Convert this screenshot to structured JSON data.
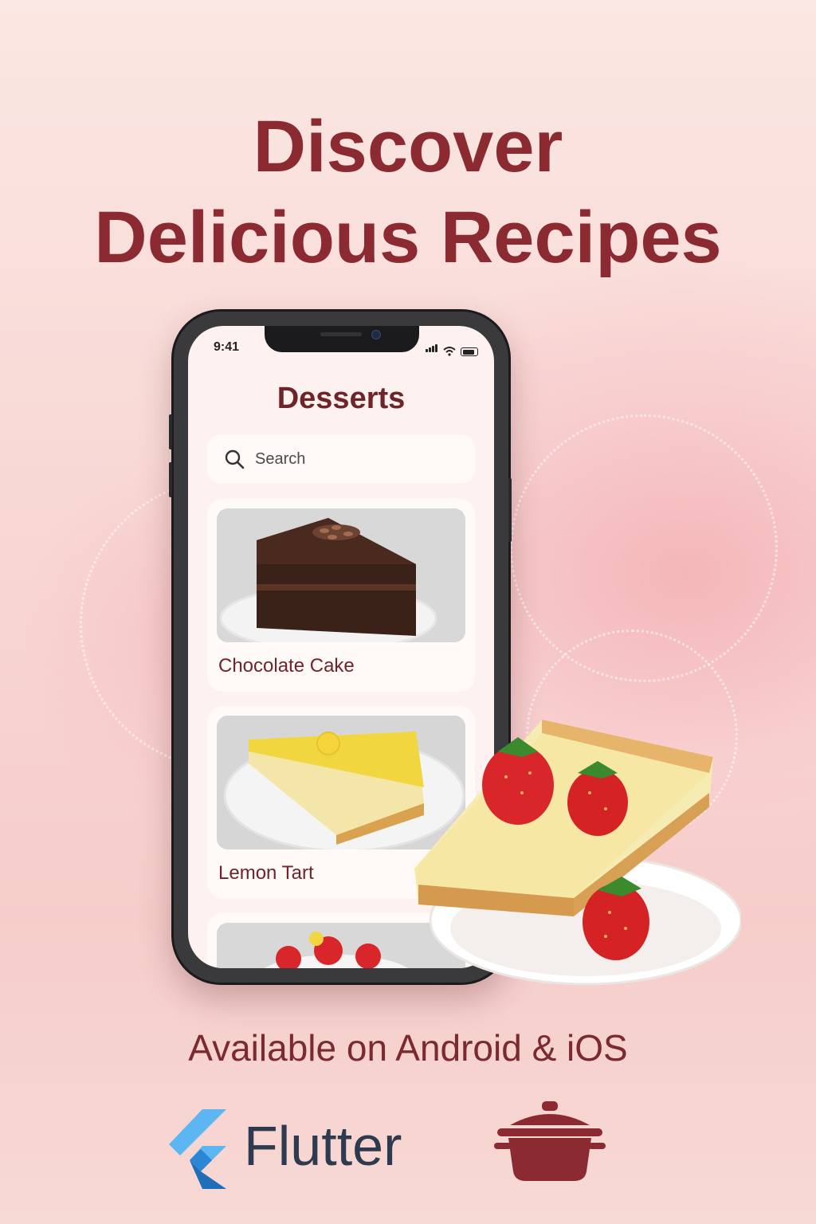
{
  "hero": {
    "headline_line1": "Discover",
    "headline_line2": "Delicious Recipes"
  },
  "phone": {
    "status_time": "9:41",
    "status_icons": [
      "signal-icon",
      "wifi-icon",
      "battery-icon"
    ],
    "screen_title": "Desserts",
    "search": {
      "placeholder": "Search",
      "icon": "search-icon"
    },
    "recipes": [
      {
        "label": "Chocolate Cake"
      },
      {
        "label": "Lemon Tart"
      },
      {
        "label": ""
      }
    ]
  },
  "footer": {
    "tagline": "Available on Android & iOS",
    "brand_text": "Flutter",
    "icons": [
      "flutter-logo-icon",
      "cooking-pot-icon"
    ]
  },
  "colors": {
    "accent": "#8b2a30",
    "screen_bg": "#fdf2ef",
    "card_bg": "#fffaf8",
    "flutter_blue": "#4fa7e8",
    "flutter_dark": "#2e3a4f"
  }
}
